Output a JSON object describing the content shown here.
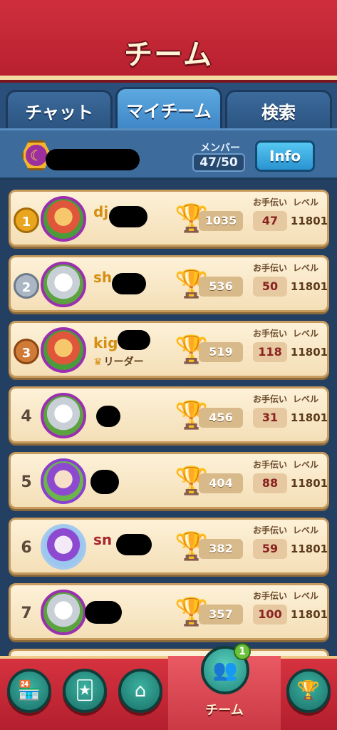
{
  "header": {
    "title": "チーム"
  },
  "tabs": [
    {
      "label": "チャット",
      "active": false
    },
    {
      "label": "マイチーム",
      "active": true
    },
    {
      "label": "検索",
      "active": false
    }
  ],
  "team": {
    "members_label": "メンバー",
    "members_count": "47/50",
    "info_label": "Info"
  },
  "list_labels": {
    "help": "お手伝い",
    "level": "レベル"
  },
  "members": [
    {
      "rank": "1",
      "name": "dj",
      "trophies": "1035",
      "help": "47",
      "level": "11801",
      "role": ""
    },
    {
      "rank": "2",
      "name": "sh",
      "trophies": "536",
      "help": "50",
      "level": "11801",
      "role": ""
    },
    {
      "rank": "3",
      "name": "kig",
      "trophies": "519",
      "help": "118",
      "level": "11801",
      "role": "リーダー"
    },
    {
      "rank": "4",
      "name": "",
      "trophies": "456",
      "help": "31",
      "level": "11801",
      "role": ""
    },
    {
      "rank": "5",
      "name": "",
      "trophies": "404",
      "help": "88",
      "level": "11801",
      "role": ""
    },
    {
      "rank": "6",
      "name": "sn",
      "trophies": "382",
      "help": "59",
      "level": "11801",
      "role": ""
    },
    {
      "rank": "7",
      "name": "",
      "trophies": "357",
      "help": "100",
      "level": "11801",
      "role": ""
    }
  ],
  "bottom_nav": {
    "active_label": "チーム",
    "team_badge": "1",
    "icons": [
      "shop-icon",
      "cards-icon",
      "home-icon",
      "team-icon",
      "trophy-icon"
    ]
  },
  "colors": {
    "header": "#cf2f3d",
    "bar": "#3d6c9c",
    "row": "#fdf1d8",
    "accent": "#d68f12"
  }
}
